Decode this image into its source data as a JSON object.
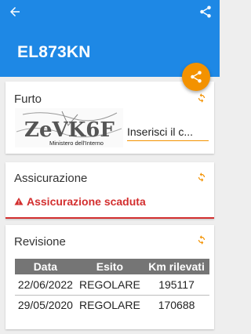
{
  "app": {
    "plate": "EL873KN",
    "back_icon": "arrow-left-icon",
    "share_icon": "share-icon",
    "fab_icon": "share-icon",
    "accent_color": "#f39200",
    "appbar_color": "#1e88e5",
    "alert_color": "#d32f2f"
  },
  "furto": {
    "title": "Furto",
    "refresh_icon": "refresh-icon",
    "captcha_text": "ZeVK6F",
    "captcha_footer": "Ministero dell'Interno",
    "captcha_input_placeholder": "Inserisci il c..."
  },
  "assicurazione": {
    "title": "Assicurazione",
    "refresh_icon": "refresh-icon",
    "alert_icon": "warning-icon",
    "status": "Assicurazione scaduta"
  },
  "revisione": {
    "title": "Revisione",
    "refresh_icon": "refresh-icon",
    "columns": [
      "Data",
      "Esito",
      "Km rilevati"
    ],
    "rows": [
      [
        "22/06/2022",
        "REGOLARE",
        "195117"
      ],
      [
        "29/05/2020",
        "REGOLARE",
        "170688"
      ]
    ]
  }
}
